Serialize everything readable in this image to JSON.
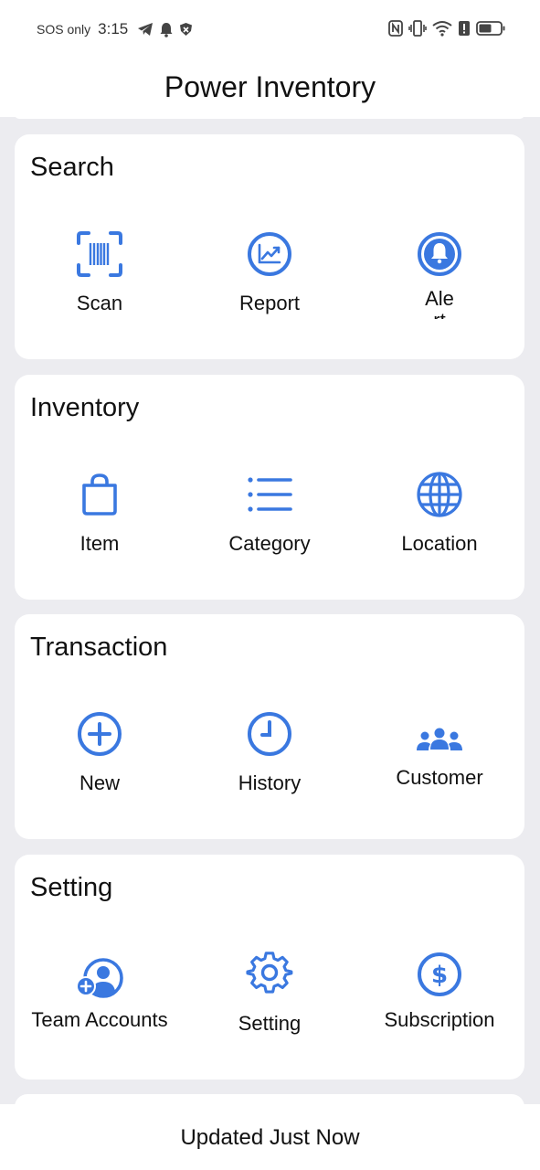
{
  "status_bar": {
    "carrier": "SOS only",
    "time": "3:15",
    "left_icons": [
      "telegram-icon",
      "notification-bell-icon",
      "vpn-shield-icon"
    ],
    "right_icons": [
      "nfc-icon",
      "vibrate-icon",
      "wifi-icon",
      "alert-icon",
      "battery-icon"
    ]
  },
  "header": {
    "title": "Power Inventory"
  },
  "sections": [
    {
      "title": "Search",
      "items": [
        {
          "label": "Scan",
          "icon": "barcode-scan-icon"
        },
        {
          "label": "Report",
          "icon": "report-chart-icon"
        },
        {
          "label": "Ale rt",
          "icon": "alert-bell-icon"
        }
      ]
    },
    {
      "title": "Inventory",
      "items": [
        {
          "label": "Item",
          "icon": "shopping-bag-icon"
        },
        {
          "label": "Category",
          "icon": "list-icon"
        },
        {
          "label": "Location",
          "icon": "globe-icon"
        }
      ]
    },
    {
      "title": "Transaction",
      "items": [
        {
          "label": "New",
          "icon": "add-circle-icon"
        },
        {
          "label": "History",
          "icon": "clock-icon"
        },
        {
          "label": "Customer",
          "icon": "people-group-icon"
        }
      ]
    },
    {
      "title": "Setting",
      "items": [
        {
          "label": "Team Accounts",
          "icon": "add-user-icon"
        },
        {
          "label": "Setting",
          "icon": "gear-icon"
        },
        {
          "label": "Subscription",
          "icon": "dollar-circle-icon"
        }
      ]
    }
  ],
  "footer": {
    "status": "Updated Just Now"
  },
  "colors": {
    "accent": "#3a78e0",
    "background": "#ececf0",
    "card": "#ffffff"
  }
}
